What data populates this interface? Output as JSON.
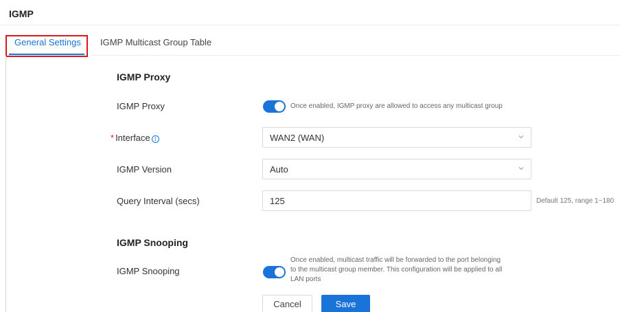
{
  "page": {
    "title": "IGMP"
  },
  "tabs": [
    {
      "label": "General Settings",
      "active": true
    },
    {
      "label": "IGMP Multicast Group Table",
      "active": false
    }
  ],
  "proxy": {
    "section_title": "IGMP Proxy",
    "toggle_label": "IGMP Proxy",
    "enabled": true,
    "toggle_desc": "Once enabled, IGMP proxy are allowed to access any multicast group",
    "interface_label": "Interface",
    "interface_required_mark": "*",
    "interface_value": "WAN2 (WAN)",
    "version_label": "IGMP Version",
    "version_value": "Auto",
    "interval_label": "Query Interval (secs)",
    "interval_value": "125",
    "interval_hint": "Default 125, range 1~180"
  },
  "snooping": {
    "section_title": "IGMP Snooping",
    "toggle_label": "IGMP Snooping",
    "enabled": true,
    "desc_lines": [
      "Once enabled, multicast traffic will be forwarded to the port belonging",
      "to the multicast group member. This configuration will be applied to all",
      "LAN ports"
    ]
  },
  "actions": {
    "cancel_label": "Cancel",
    "save_label": "Save"
  },
  "colors": {
    "accent": "#1a73d9",
    "highlight_box": "#d7191c",
    "required": "#e2231a"
  },
  "icons": {
    "info": "info-circle-icon",
    "dropdown": "chevron-down-icon"
  }
}
